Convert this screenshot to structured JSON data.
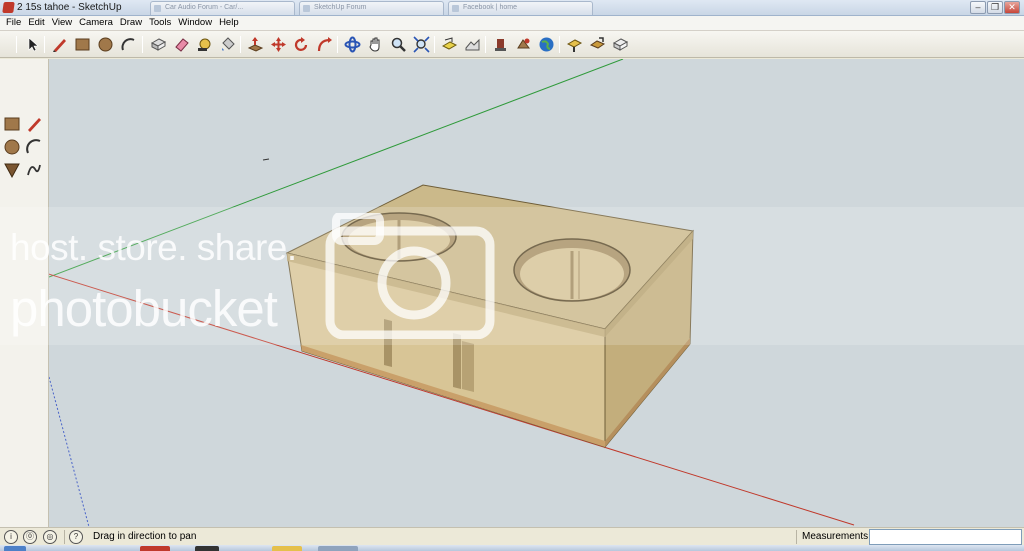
{
  "window": {
    "title": "2 15s tahoe - SketchUp",
    "browser_tabs": [
      "Car Audio Forum - Car/...",
      "SketchUp Forum",
      "Facebook | home"
    ],
    "controls": [
      "minimize",
      "restore",
      "close"
    ]
  },
  "menu": [
    "File",
    "Edit",
    "View",
    "Camera",
    "Draw",
    "Tools",
    "Window",
    "Help"
  ],
  "toolbar": {
    "tools": [
      {
        "name": "select-tool-icon",
        "glyph": "select"
      },
      {
        "name": "line-tool-icon",
        "glyph": "pencil"
      },
      {
        "name": "rectangle-tool-icon",
        "glyph": "rectangle"
      },
      {
        "name": "circle-tool-icon",
        "glyph": "circle"
      },
      {
        "name": "arc-tool-icon",
        "glyph": "arc"
      },
      {
        "name": "make-component-icon",
        "glyph": "component"
      },
      {
        "name": "eraser-tool-icon",
        "glyph": "eraser"
      },
      {
        "name": "tape-measure-icon",
        "glyph": "tape"
      },
      {
        "name": "paint-bucket-icon",
        "glyph": "bucket"
      },
      {
        "name": "push-pull-icon",
        "glyph": "pushpull"
      },
      {
        "name": "move-tool-icon",
        "glyph": "move"
      },
      {
        "name": "rotate-tool-icon",
        "glyph": "rotate"
      },
      {
        "name": "follow-me-icon",
        "glyph": "followme"
      },
      {
        "name": "orbit-tool-icon",
        "glyph": "orbit"
      },
      {
        "name": "pan-tool-icon",
        "glyph": "pan"
      },
      {
        "name": "zoom-tool-icon",
        "glyph": "zoom"
      },
      {
        "name": "zoom-extents-icon",
        "glyph": "zoomext"
      },
      {
        "name": "add-location-icon",
        "glyph": "location"
      },
      {
        "name": "toggle-terrain-icon",
        "glyph": "terrain"
      },
      {
        "name": "get-models-icon",
        "glyph": "models"
      },
      {
        "name": "share-model-icon",
        "glyph": "share"
      },
      {
        "name": "preview-google-earth-icon",
        "glyph": "earth"
      },
      {
        "name": "get-photo-texture-icon",
        "glyph": "getmodels"
      },
      {
        "name": "share-component-icon",
        "glyph": "sharecomp"
      },
      {
        "name": "extension-warehouse-icon",
        "glyph": "ext"
      }
    ]
  },
  "palette": {
    "tools": [
      "rectangle-tool",
      "line-tool",
      "circle-tool",
      "arc-tool",
      "polygon-tool",
      "freehand-tool"
    ]
  },
  "watermark": {
    "line1": "host. store. share.",
    "line2": "photobucket"
  },
  "status": {
    "hint": "Drag in direction to pan",
    "measurements_label": "Measurements",
    "measurements_value": ""
  },
  "colors": {
    "viewport_bg": "#cfd7db",
    "wood_top": "#c8b88a",
    "wood_front": "#d9c79a",
    "wood_side": "#c2ad78",
    "axis_green": "#2f9a3a",
    "axis_red": "#c0392b",
    "axis_blue": "#4a64c8"
  }
}
